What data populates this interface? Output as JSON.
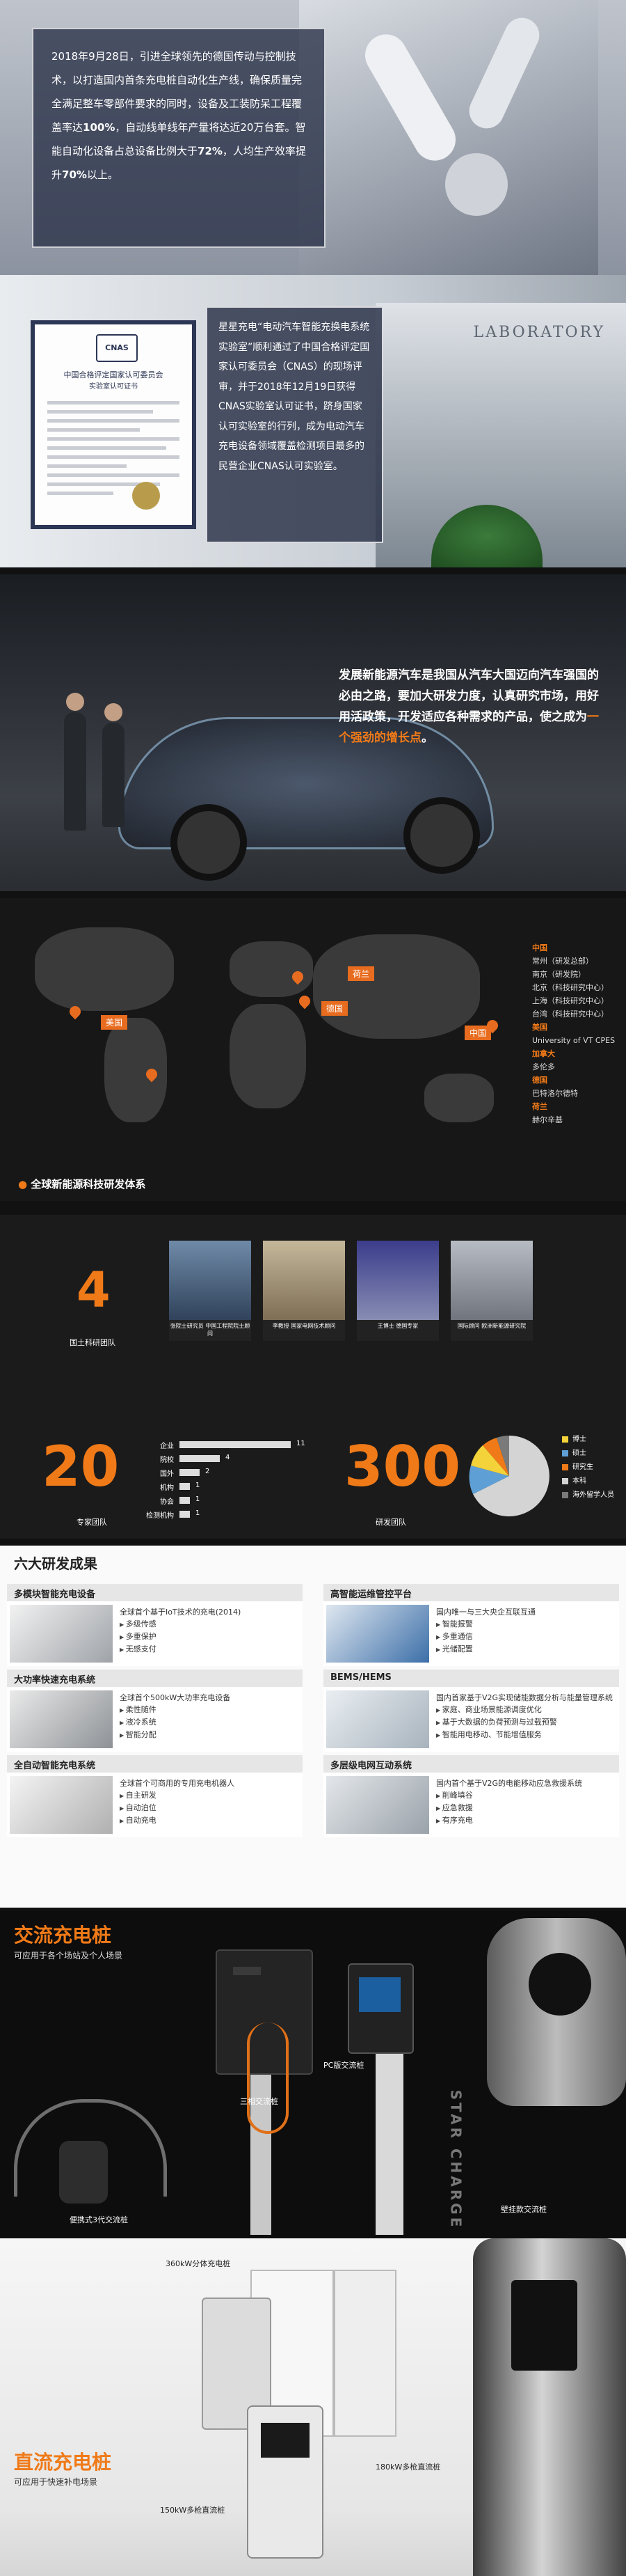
{
  "intro": {
    "text_pre": "2018年9月28日，引进全球领先的德国传动与控制技术，以打造国内首条充电桩自动化生产线，确保质量完全满足整车零部件要求的同时，设备及工装防呆工程覆盖率达",
    "pct1": "100%",
    "text_mid": "，自动线单线年产量将达近20万台套。智能自动化设备占总设备比例大于",
    "pct2": "72%",
    "text_mid2": "，人均生产效率提升",
    "pct3": "70%",
    "text_post": "以上。"
  },
  "cert": {
    "logo": "CNAS",
    "title": "中国合格评定国家认可委员会",
    "subtitle": "实验室认可证书",
    "text": "星星充电“电动汽车智能充换电系统实验室”顺利通过了中国合格评定国家认可委员会（CNAS）的现场评审，并于2018年12月19日获得CNAS实验室认可证书，跻身国家认可实验室的行列，成为电动汽车充电设备领域覆盖检测项目最多的民营企业CNAS认可实验室。",
    "lab_sign": "LABORATORY"
  },
  "vision": {
    "text": "发展新能源汽车是我国从汽车大国迈向汽车强国的必由之路，要加大研发力度，认真研究市场，用好用活政策，开发适应各种需求的产品，使之成为一个强劲的增长点。"
  },
  "map": {
    "tags": [
      "美国",
      "德国",
      "荷兰",
      "中国"
    ],
    "sidebar": [
      {
        "country": "中国",
        "sites": [
          "常州（研发总部）",
          "南京（研发院）",
          "北京（科技研究中心）",
          "上海（科技研究中心）",
          "台湾（科技研究中心）"
        ]
      },
      {
        "country": "美国",
        "sites": [
          "University of VT CPES"
        ]
      },
      {
        "country": "加拿大",
        "sites": [
          "多伦多"
        ]
      },
      {
        "country": "德国",
        "sites": [
          "巴特洛尔德特"
        ]
      },
      {
        "country": "荷兰",
        "sites": [
          "赫尔辛基"
        ]
      }
    ],
    "footer": "全球新能源科技研发体系"
  },
  "team": {
    "centers_num": "4",
    "centers_label": "国土科研团队",
    "experts": [
      {
        "caption": "张院士研究员\n中国工程院院士顾问"
      },
      {
        "caption": "李教授\n国家电网技术顾问"
      },
      {
        "caption": "王博士\n德国专家"
      },
      {
        "caption": "国际顾问\n欧洲新能源研究院"
      }
    ],
    "experts_num": "20",
    "experts_label": "专家团队",
    "bars": [
      {
        "label": "企业",
        "value": "11"
      },
      {
        "label": "院校",
        "value": "4"
      },
      {
        "label": "国外",
        "value": "2"
      },
      {
        "label": "机构",
        "value": "1"
      },
      {
        "label": "协会",
        "value": "1"
      },
      {
        "label": "检测机构",
        "value": "1"
      }
    ],
    "staff_num": "300",
    "staff_label": "研发团队",
    "legend": [
      "博士",
      "硕士",
      "研究生",
      "本科",
      "海外留学人员"
    ]
  },
  "results": {
    "title": "六大研发成果",
    "cards": [
      {
        "head": "多模块智能充电设备",
        "lines": [
          "全球首个基于IoT技术的充电(2014)",
          "多级传感",
          "多重保护",
          "无感支付"
        ]
      },
      {
        "head": "高智能运维管控平台",
        "lines": [
          "国内唯一与三大央企互联互通",
          "智能报警",
          "多重通信",
          "光储配置"
        ]
      },
      {
        "head": "大功率快速充电系统",
        "lines": [
          "全球首个500kW大功率充电设备",
          "柔性随件",
          "液冷系统",
          "智能分配"
        ]
      },
      {
        "head": "BEMS/HEMS",
        "lines": [
          "国内首家基于V2G实现储能数据分析与能量管理系统",
          "家庭、商业场景能源调度优化",
          "基于大数据的负荷预测与过载预警",
          "智能用电移动、节能增值服务"
        ]
      },
      {
        "head": "全自动智能充电系统",
        "lines": [
          "全球首个可商用的专用充电机器人",
          "自主研发",
          "自动泊位",
          "自动充电"
        ]
      },
      {
        "head": "多层级电网互动系统",
        "lines": [
          "国内首个基于V2G的电能移动应急救援系统",
          "削峰填谷",
          "应急救援",
          "有序充电"
        ]
      }
    ]
  },
  "ac": {
    "title": "交流充电桩",
    "sub": "可应用于各个场站及个人场景",
    "labels": [
      "三相交流桩",
      "PC版交流桩",
      "便携式3代交流桩",
      "壁挂款交流桩"
    ],
    "brand": "STAR CHARGE"
  },
  "dc": {
    "title": "直流充电桩",
    "sub": "可应用于快速补电场景",
    "labels": [
      "360kW分体充电桩",
      "180kW多枪直流桩",
      "150kW多枪直流桩"
    ]
  }
}
